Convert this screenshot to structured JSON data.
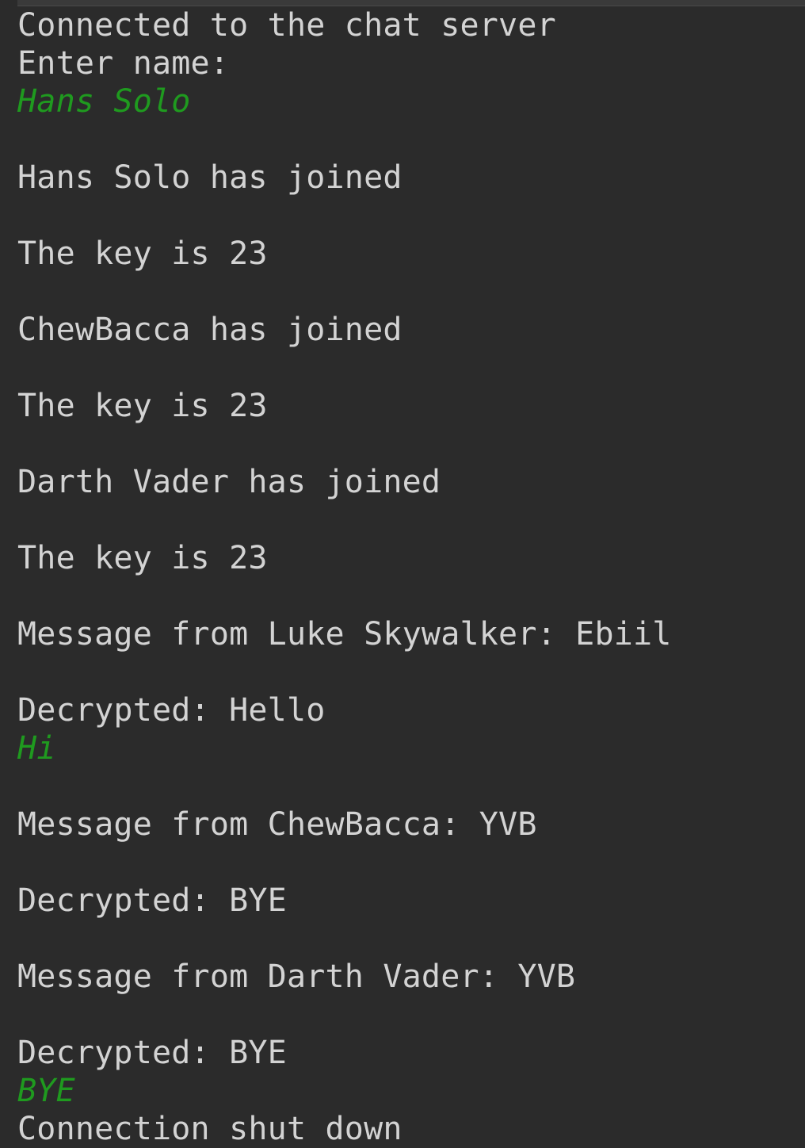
{
  "console": {
    "lines": [
      {
        "text": "Connected to the chat server",
        "kind": "output"
      },
      {
        "text": "Enter name:",
        "kind": "output"
      },
      {
        "text": "Hans Solo",
        "kind": "input"
      },
      {
        "text": "",
        "kind": "blank"
      },
      {
        "text": "Hans Solo has joined",
        "kind": "output"
      },
      {
        "text": "",
        "kind": "blank"
      },
      {
        "text": "The key is 23",
        "kind": "output"
      },
      {
        "text": "",
        "kind": "blank"
      },
      {
        "text": "ChewBacca has joined",
        "kind": "output"
      },
      {
        "text": "",
        "kind": "blank"
      },
      {
        "text": "The key is 23",
        "kind": "output"
      },
      {
        "text": "",
        "kind": "blank"
      },
      {
        "text": "Darth Vader has joined",
        "kind": "output"
      },
      {
        "text": "",
        "kind": "blank"
      },
      {
        "text": "The key is 23",
        "kind": "output"
      },
      {
        "text": "",
        "kind": "blank"
      },
      {
        "text": "Message from Luke Skywalker: Ebiil",
        "kind": "output"
      },
      {
        "text": "",
        "kind": "blank"
      },
      {
        "text": "Decrypted: Hello",
        "kind": "output"
      },
      {
        "text": "Hi",
        "kind": "input"
      },
      {
        "text": "",
        "kind": "blank"
      },
      {
        "text": "Message from ChewBacca: YVB",
        "kind": "output"
      },
      {
        "text": "",
        "kind": "blank"
      },
      {
        "text": "Decrypted: BYE",
        "kind": "output"
      },
      {
        "text": "",
        "kind": "blank"
      },
      {
        "text": "Message from Darth Vader: YVB",
        "kind": "output"
      },
      {
        "text": "",
        "kind": "blank"
      },
      {
        "text": "Decrypted: BYE",
        "kind": "output"
      },
      {
        "text": "BYE",
        "kind": "input"
      },
      {
        "text": "Connection shut down",
        "kind": "output"
      }
    ]
  },
  "colors": {
    "background": "#2b2b2b",
    "output_text": "#d3d3d3",
    "user_input_text": "#1f9a1f"
  }
}
